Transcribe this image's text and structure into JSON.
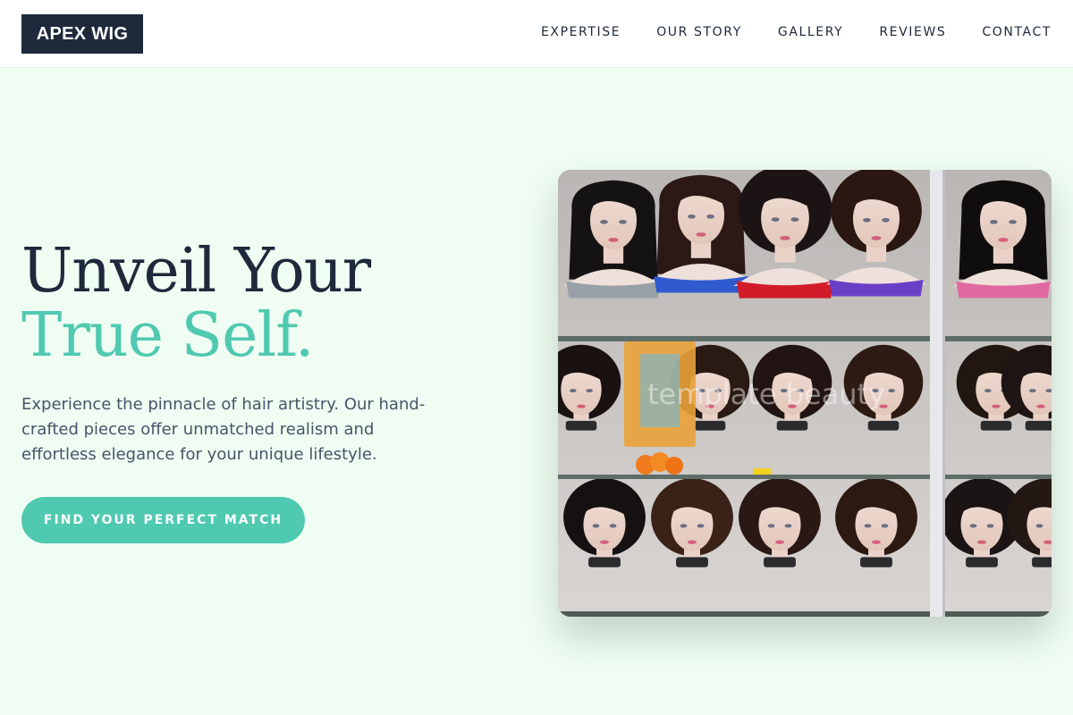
{
  "brand": {
    "logo_text": "APEX WIG"
  },
  "nav": {
    "items": [
      {
        "label": "EXPERTISE"
      },
      {
        "label": "OUR STORY"
      },
      {
        "label": "GALLERY"
      },
      {
        "label": "REVIEWS"
      },
      {
        "label": "CONTACT"
      }
    ]
  },
  "hero": {
    "headline_line1": "Unveil Your",
    "headline_line2": "True Self.",
    "description": "Experience the pinnacle of hair artistry. Our hand-crafted pieces offer unmatched realism and effortless elegance for your unique lifestyle.",
    "cta_label": "FIND YOUR PERFECT MATCH",
    "image_watermark": "template beauty"
  },
  "colors": {
    "page_background": "#effdf2",
    "brand_dark": "#1e293b",
    "accent": "#4fc9b0",
    "body_text": "#475569"
  }
}
